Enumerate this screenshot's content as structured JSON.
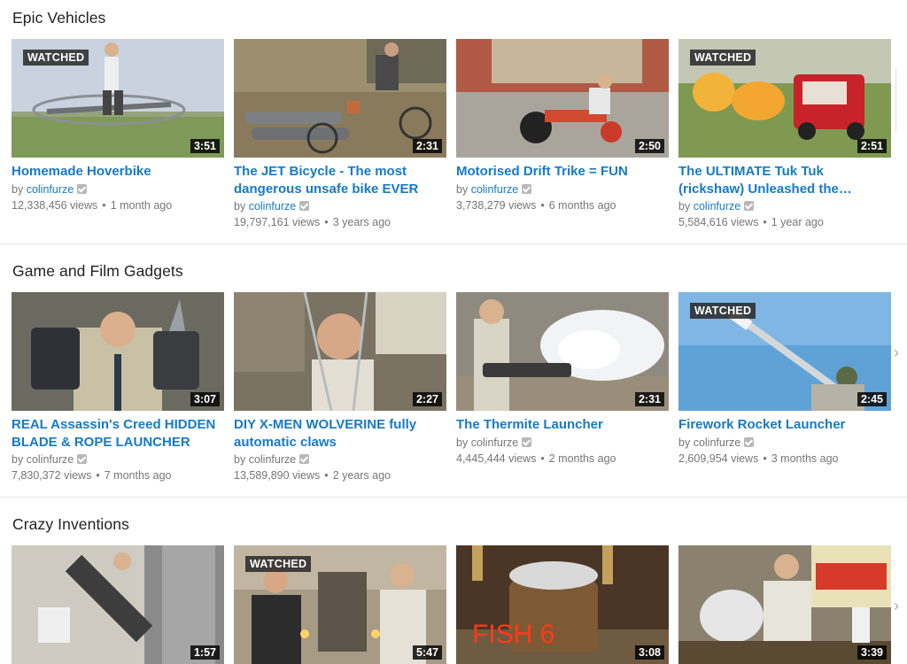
{
  "sections": [
    {
      "title": "Epic Vehicles",
      "videos": [
        {
          "title": "Homemade Hoverbike",
          "channel": "colinfurze",
          "channel_link": true,
          "views": "12,338,456 views",
          "age": "1 month ago",
          "duration": "3:51",
          "watched": "WATCHED"
        },
        {
          "title": "The JET Bicycle - The most dangerous unsafe bike EVER",
          "channel": "colinfurze",
          "channel_link": true,
          "views": "19,797,161 views",
          "age": "3 years ago",
          "duration": "2:31",
          "watched": ""
        },
        {
          "title": "Motorised Drift Trike = FUN",
          "channel": "colinfurze",
          "channel_link": true,
          "views": "3,738,279 views",
          "age": "6 months ago",
          "duration": "2:50",
          "watched": ""
        },
        {
          "title": "The ULTIMATE Tuk Tuk (rickshaw) Unleashed the…",
          "channel": "colinfurze",
          "channel_link": true,
          "views": "5,584,616 views",
          "age": "1 year ago",
          "duration": "2:51",
          "watched": "WATCHED"
        }
      ]
    },
    {
      "title": "Game and Film Gadgets",
      "videos": [
        {
          "title": "REAL Assassin's Creed HIDDEN BLADE & ROPE LAUNCHER",
          "channel": "colinfurze",
          "channel_link": false,
          "views": "7,830,372 views",
          "age": "7 months ago",
          "duration": "3:07",
          "watched": ""
        },
        {
          "title": "DIY X-MEN WOLVERINE fully automatic claws",
          "channel": "colinfurze",
          "channel_link": false,
          "views": "13,589,890 views",
          "age": "2 years ago",
          "duration": "2:27",
          "watched": ""
        },
        {
          "title": "The Thermite Launcher",
          "channel": "colinfurze",
          "channel_link": false,
          "views": "4,445,444 views",
          "age": "2 months ago",
          "duration": "2:31",
          "watched": ""
        },
        {
          "title": "Firework Rocket Launcher",
          "channel": "colinfurze",
          "channel_link": false,
          "views": "2,609,954 views",
          "age": "3 months ago",
          "duration": "2:45",
          "watched": "WATCHED"
        }
      ]
    },
    {
      "title": "Crazy Inventions",
      "videos": [
        {
          "title": "",
          "channel": "",
          "channel_link": false,
          "views": "",
          "age": "",
          "duration": "1:57",
          "watched": ""
        },
        {
          "title": "",
          "channel": "",
          "channel_link": false,
          "views": "",
          "age": "",
          "duration": "5:47",
          "watched": "WATCHED"
        },
        {
          "title": "",
          "channel": "",
          "channel_link": false,
          "views": "",
          "age": "",
          "duration": "3:08",
          "watched": "",
          "overlay_text": "FISH 6"
        },
        {
          "title": "",
          "channel": "",
          "channel_link": false,
          "views": "",
          "age": "",
          "duration": "3:39",
          "watched": ""
        }
      ]
    }
  ],
  "by_prefix": "by",
  "dot": "•",
  "next_arrow": "›",
  "colors": {
    "link": "#167ac6",
    "meta": "#767676"
  }
}
